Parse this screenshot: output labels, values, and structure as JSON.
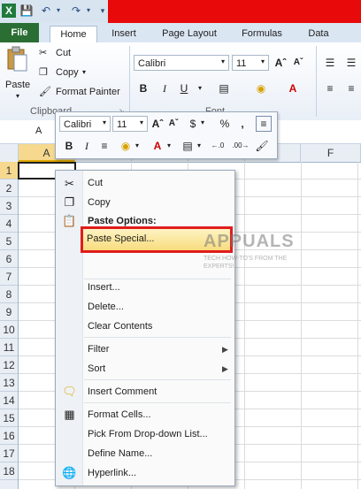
{
  "quick_access": {
    "icons": [
      "excel-icon",
      "save-icon",
      "undo-icon",
      "redo-icon",
      "customize-icon"
    ]
  },
  "tabs": [
    "File",
    "Home",
    "Insert",
    "Page Layout",
    "Formulas",
    "Data"
  ],
  "ribbon": {
    "paste_label": "Paste",
    "cut_label": "Cut",
    "copy_label": "Copy",
    "format_painter_label": "Format Painter",
    "clipboard_group": "Clipboard",
    "font_group": "Font",
    "font_name": "Calibri",
    "font_size": "11"
  },
  "formula_bar": {
    "name_box": "A"
  },
  "mini_toolbar": {
    "font_name": "Calibri",
    "font_size": "11",
    "currency": "$",
    "percent": "%",
    "comma": ",",
    "inc_decimal": ".0→.00",
    "dec_decimal": ".00→.0"
  },
  "columns": [
    "A",
    "F"
  ],
  "rows": [
    "1",
    "2",
    "3",
    "4",
    "5",
    "6",
    "7",
    "8",
    "9",
    "10",
    "11",
    "12",
    "13",
    "14",
    "15",
    "16",
    "17",
    "18"
  ],
  "context_menu": {
    "cut": "Cut",
    "copy": "Copy",
    "paste_options": "Paste Options:",
    "paste_special": "Paste Special...",
    "insert": "Insert...",
    "delete": "Delete...",
    "clear_contents": "Clear Contents",
    "filter": "Filter",
    "sort": "Sort",
    "insert_comment": "Insert Comment",
    "format_cells": "Format Cells...",
    "pick_dropdown": "Pick From Drop-down List...",
    "define_name": "Define Name...",
    "hyperlink": "Hyperlink..."
  },
  "watermark": {
    "brand": "APPUALS",
    "tagline": "TECH HOW-TO'S FROM THE EXPERTS!"
  },
  "colors": {
    "title_red": "#e8090b",
    "file_tab": "#2a6e33",
    "highlight": "#f8d975",
    "annotation_red": "#e01c1c"
  }
}
